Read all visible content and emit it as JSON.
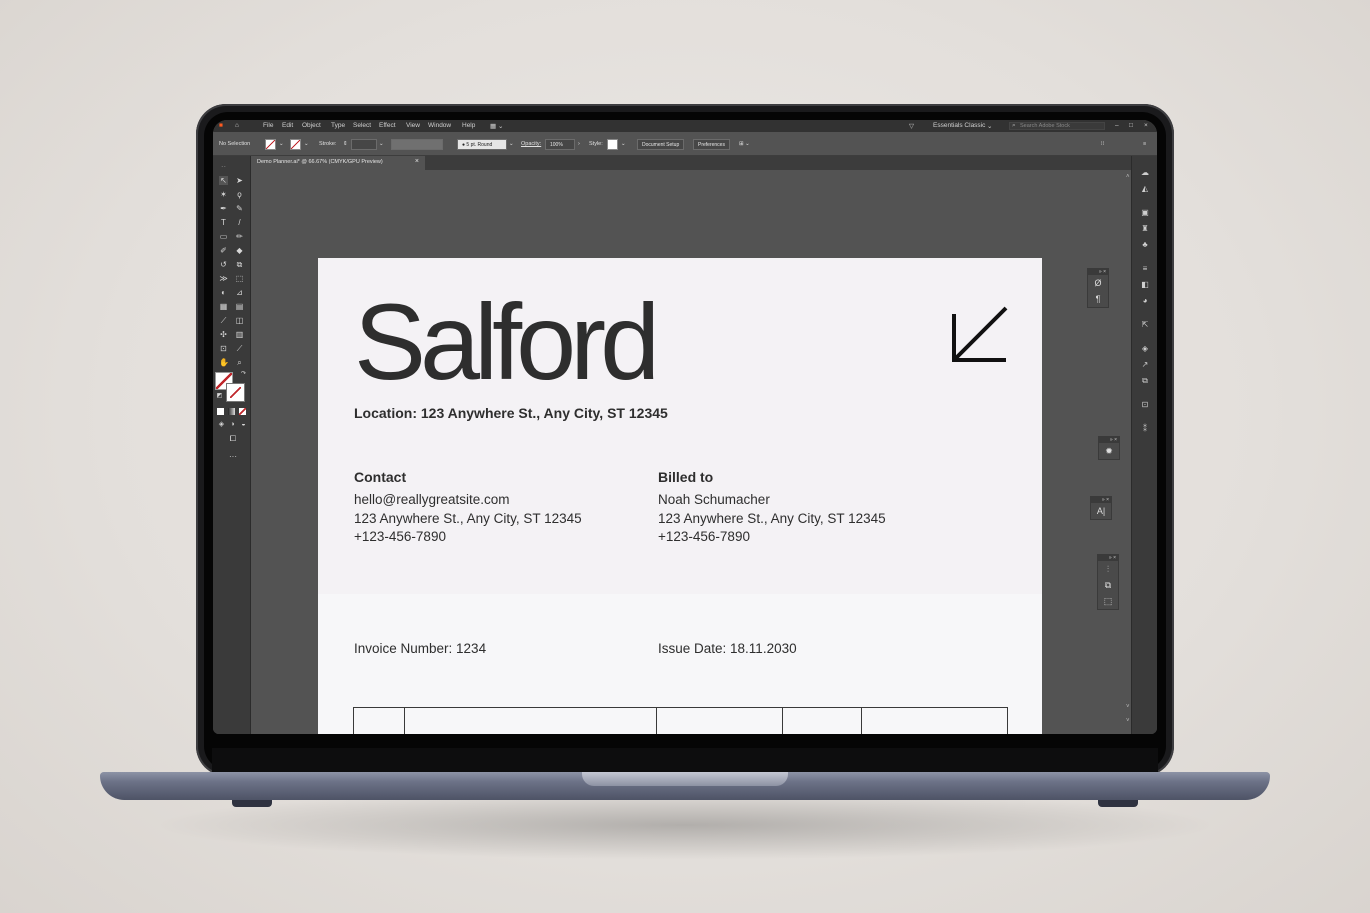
{
  "app": {
    "menu": [
      "File",
      "Edit",
      "Object",
      "Type",
      "Select",
      "Effect",
      "View",
      "Window",
      "Help"
    ],
    "workspace": "Essentials Classic",
    "search_placeholder": "Search Adobe Stock"
  },
  "control_bar": {
    "selection": "No Selection",
    "stroke_label": "Stroke:",
    "brush": "5 pt. Round",
    "opacity_label": "Opacity:",
    "opacity_value": "100%",
    "style_label": "Style:",
    "document_setup": "Document Setup",
    "preferences": "Preferences"
  },
  "tab": {
    "title": "Demo Planner.ai* @ 66.67% (CMYK/GPU Preview)",
    "close": "×"
  },
  "document": {
    "title": "Salford",
    "location": "Location: 123 Anywhere St., Any City, ST 12345",
    "contact": {
      "heading": "Contact",
      "email": "hello@reallygreatsite.com",
      "address": "123 Anywhere St., Any City, ST 12345",
      "phone": "+123-456-7890"
    },
    "billed_to": {
      "heading": "Billed to",
      "name": "Noah Schumacher",
      "address": "123 Anywhere St., Any City, ST 12345",
      "phone": "+123-456-7890"
    },
    "invoice_number": "Invoice Number: 1234",
    "issue_date": "Issue Date: 18.11.2030"
  },
  "icons": {
    "tools": [
      "selection-tool",
      "direct-selection-tool",
      "magic-wand-tool",
      "lasso-tool",
      "pen-tool",
      "curvature-tool",
      "type-tool",
      "line-tool",
      "rectangle-tool",
      "paintbrush-tool",
      "shaper-tool",
      "eraser-tool",
      "rotate-tool",
      "scale-tool",
      "width-tool",
      "free-transform-tool",
      "shape-builder-tool",
      "perspective-tool",
      "mesh-tool",
      "gradient-tool",
      "eyedropper-tool",
      "blend-tool",
      "symbol-sprayer-tool",
      "column-graph-tool",
      "artboard-tool",
      "slice-tool",
      "hand-tool",
      "zoom-tool"
    ],
    "doc_arrow": "arrow-down-left-icon"
  }
}
